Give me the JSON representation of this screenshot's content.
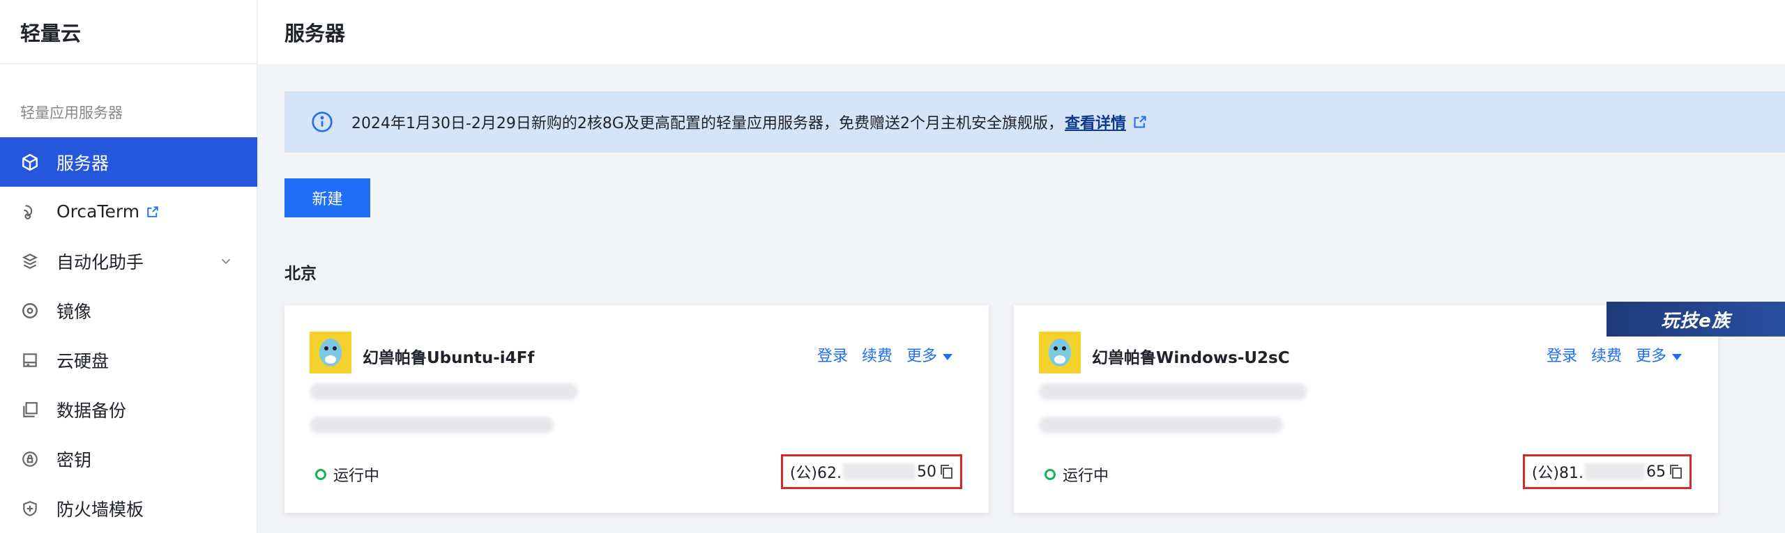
{
  "sidebar": {
    "brand": "轻量云",
    "section": "轻量应用服务器",
    "items": [
      {
        "label": "服务器",
        "icon": "cube-icon"
      },
      {
        "label": "OrcaTerm",
        "icon": "terminal-icon"
      },
      {
        "label": "自动化助手",
        "icon": "automation-icon"
      },
      {
        "label": "镜像",
        "icon": "disc-icon"
      },
      {
        "label": "云硬盘",
        "icon": "disk-icon"
      },
      {
        "label": "数据备份",
        "icon": "backup-icon"
      },
      {
        "label": "密钥",
        "icon": "key-icon"
      },
      {
        "label": "防火墙模板",
        "icon": "shield-icon"
      }
    ]
  },
  "header": {
    "title": "服务器"
  },
  "notice": {
    "text": "2024年1月30日-2月29日新购的2核8G及更高配置的轻量应用服务器，免费赠送2个月主机安全旗舰版，",
    "link": "查看详情"
  },
  "new_button": "新建",
  "region": "北京",
  "cards": [
    {
      "title": "幻兽帕鲁Ubuntu-i4Ff",
      "actions": {
        "login": "登录",
        "renew": "续费",
        "more": "更多"
      },
      "status": "运行中",
      "ip_prefix": "(公)62.",
      "ip_suffix": "50"
    },
    {
      "title": "幻兽帕鲁Windows-U2sC",
      "actions": {
        "login": "登录",
        "renew": "续费",
        "more": "更多"
      },
      "status": "运行中",
      "ip_prefix": "(公)81.",
      "ip_suffix": "65"
    }
  ],
  "watermark": "玩技e族",
  "colors": {
    "accent": "#2656dc",
    "primary_button": "#1f6ef5",
    "running": "#14b35a",
    "highlight_box": "#d42a2a"
  }
}
